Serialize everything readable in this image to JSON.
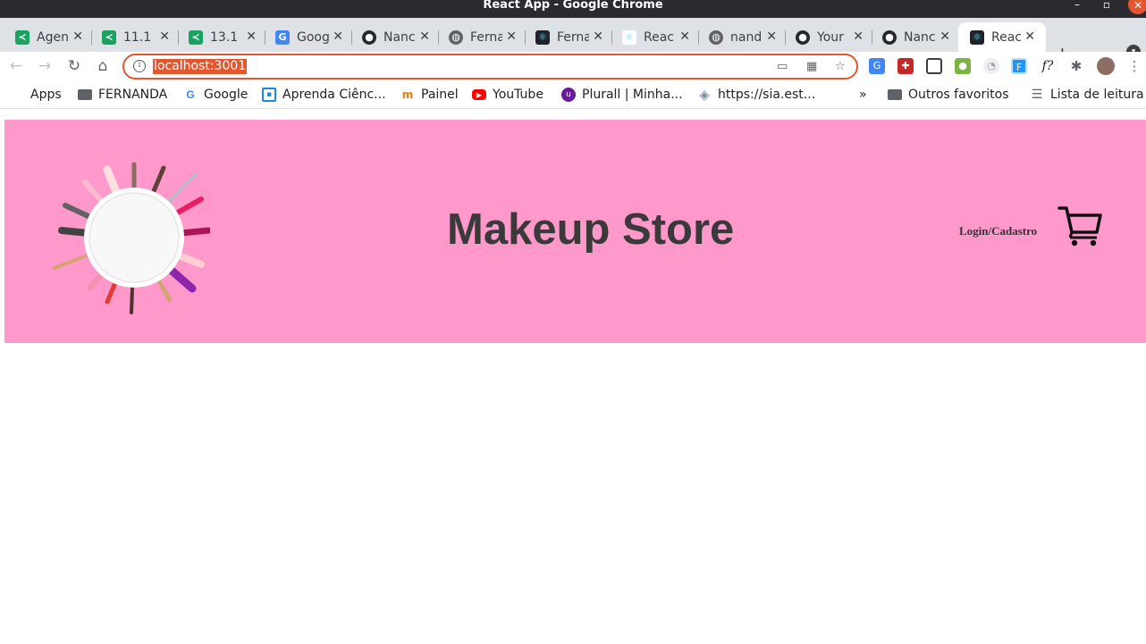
{
  "window": {
    "title": "React App - Google Chrome"
  },
  "tabs": [
    {
      "label": "Agen",
      "icon": "sheet-icon"
    },
    {
      "label": "11.1",
      "icon": "sheet-icon"
    },
    {
      "label": "13.1",
      "icon": "sheet-icon"
    },
    {
      "label": "Goog",
      "icon": "translate-icon"
    },
    {
      "label": "Nanc",
      "icon": "github-icon"
    },
    {
      "label": "Ferna",
      "icon": "globe-icon"
    },
    {
      "label": "Ferna",
      "icon": "react-icon"
    },
    {
      "label": "Reac",
      "icon": "react-icon"
    },
    {
      "label": "nand",
      "icon": "globe-icon"
    },
    {
      "label": "Your",
      "icon": "github-icon"
    },
    {
      "label": "Nanc",
      "icon": "github-icon"
    },
    {
      "label": "Reac",
      "icon": "react-icon",
      "active": true
    }
  ],
  "toolbar": {
    "url": "localhost:3001"
  },
  "bookmarks": {
    "items": [
      {
        "label": "Apps"
      },
      {
        "label": "FERNANDA"
      },
      {
        "label": "Google"
      },
      {
        "label": "Aprenda Ciênc..."
      },
      {
        "label": "Painel"
      },
      {
        "label": "YouTube"
      },
      {
        "label": "Plurall | Minha..."
      },
      {
        "label": "https://sia.est..."
      }
    ],
    "overflow": "»",
    "other": "Outros favoritos",
    "reading_list": "Lista de leitura"
  },
  "page": {
    "title": "Makeup Store",
    "login_link": "Login/Cadastro",
    "header_color": "#ff99cc"
  }
}
